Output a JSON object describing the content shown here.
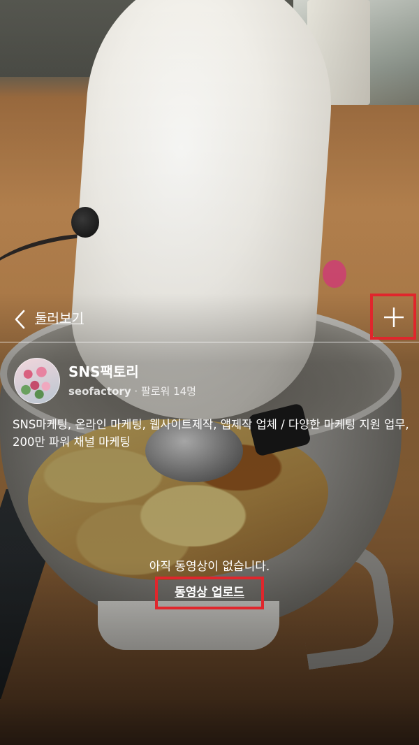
{
  "nav": {
    "back_label": "둘러보기"
  },
  "channel": {
    "name": "SNS팩토리",
    "handle": "seofactory",
    "followers": "· 팔로워 14명",
    "description": "SNS마케팅, 온라인 마케팅, 웹사이트제작, 앱제작 업체 / 다양한 마케팅 지원 업무, 200만 파워 채널 마케팅"
  },
  "empty_state": {
    "message": "아직 동영상이 없습니다.",
    "upload_label": "동영상 업로드"
  },
  "icons": {
    "back": "chevron-left-icon",
    "add": "plus-icon"
  },
  "colors": {
    "highlight_border": "#e0262c",
    "text": "#ffffff"
  }
}
